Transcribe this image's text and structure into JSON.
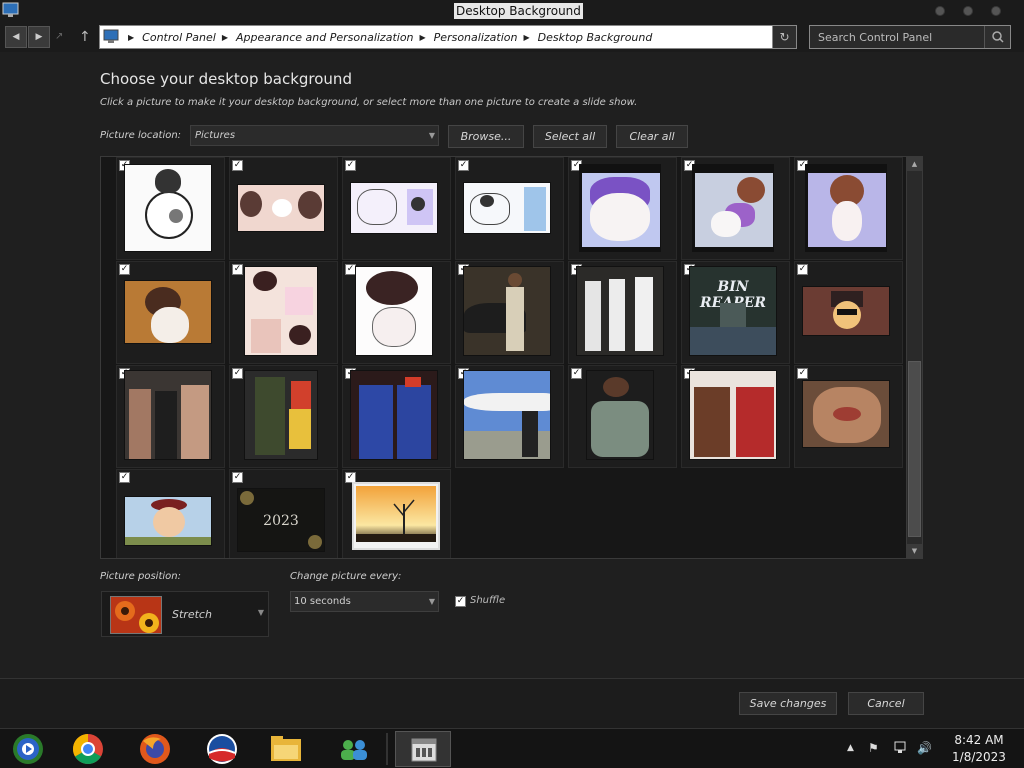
{
  "window": {
    "title": "Desktop Background"
  },
  "nav": {
    "breadcrumbs": [
      "Control Panel",
      "Appearance and Personalization",
      "Personalization",
      "Desktop Background"
    ],
    "search_placeholder": "Search Control Panel"
  },
  "main": {
    "heading": "Choose your desktop background",
    "subtext": "Click a picture to make it your desktop background, or select more than one picture to create a slide show.",
    "location_label": "Picture location:",
    "location_value": "Pictures",
    "browse_label": "Browse...",
    "select_all_label": "Select all",
    "clear_all_label": "Clear all"
  },
  "pictures": [
    {
      "checked": true,
      "thumb_text": ""
    },
    {
      "checked": true,
      "thumb_text": ""
    },
    {
      "checked": true,
      "thumb_text": ""
    },
    {
      "checked": true,
      "thumb_text": ""
    },
    {
      "checked": true,
      "thumb_text": ""
    },
    {
      "checked": true,
      "thumb_text": ""
    },
    {
      "checked": true,
      "thumb_text": ""
    },
    {
      "checked": true,
      "thumb_text": ""
    },
    {
      "checked": true,
      "thumb_text": ""
    },
    {
      "checked": true,
      "thumb_text": ""
    },
    {
      "checked": true,
      "thumb_text": ""
    },
    {
      "checked": true,
      "thumb_text": ""
    },
    {
      "checked": true,
      "thumb_text": "BIN REAPER"
    },
    {
      "checked": true,
      "thumb_text": ""
    },
    {
      "checked": true,
      "thumb_text": ""
    },
    {
      "checked": true,
      "thumb_text": ""
    },
    {
      "checked": true,
      "thumb_text": ""
    },
    {
      "checked": true,
      "thumb_text": ""
    },
    {
      "checked": true,
      "thumb_text": ""
    },
    {
      "checked": true,
      "thumb_text": ""
    },
    {
      "checked": true,
      "thumb_text": ""
    },
    {
      "checked": true,
      "thumb_text": ""
    },
    {
      "checked": true,
      "thumb_text": "2023"
    },
    {
      "checked": true,
      "thumb_text": ""
    }
  ],
  "position": {
    "label": "Picture position:",
    "value": "Stretch"
  },
  "interval": {
    "label": "Change picture every:",
    "value": "10 seconds"
  },
  "shuffle": {
    "label": "Shuffle",
    "checked": true
  },
  "footer": {
    "save_label": "Save changes",
    "cancel_label": "Cancel"
  },
  "taskbar": {
    "apps": [
      "media-center-icon",
      "chrome-icon",
      "firefox-icon",
      "obama-logo-icon",
      "file-explorer-icon",
      "network-users-icon",
      "control-panel-icon"
    ],
    "time": "8:42 AM",
    "date": "1/8/2023"
  }
}
